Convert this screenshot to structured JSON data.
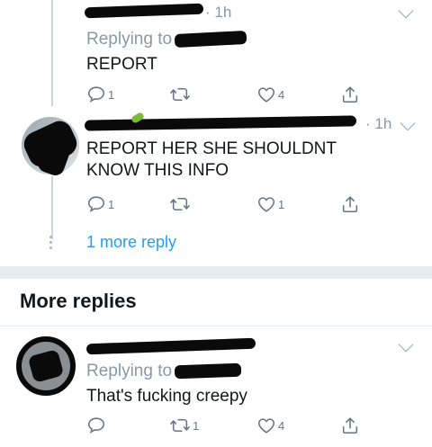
{
  "reply1": {
    "time": "· 1h",
    "replying_to_label": "Replying to",
    "text": "REPORT",
    "actions": {
      "reply_count": "1",
      "retweet_count": "",
      "like_count": "4"
    }
  },
  "reply2": {
    "time": "· 1h",
    "text": "REPORT HER SHE SHOULDNT KNOW THIS INFO",
    "actions": {
      "reply_count": "1",
      "retweet_count": "",
      "like_count": "1"
    }
  },
  "more_reply_link": "1 more reply",
  "more_replies_section": {
    "title": "More replies",
    "reply": {
      "replying_to_label": "Replying to",
      "text": "That's fucking creepy",
      "actions": {
        "reply_count": "",
        "retweet_count": "1",
        "like_count": "4"
      }
    }
  },
  "icons": [
    "reply-icon",
    "retweet-icon",
    "like-icon",
    "share-icon",
    "chevron-down-icon",
    "more-dots-icon"
  ],
  "colors": {
    "accent": "#1da1f2",
    "muted": "#8899a6",
    "text": "#14171a",
    "divider": "#e6ecf0"
  }
}
